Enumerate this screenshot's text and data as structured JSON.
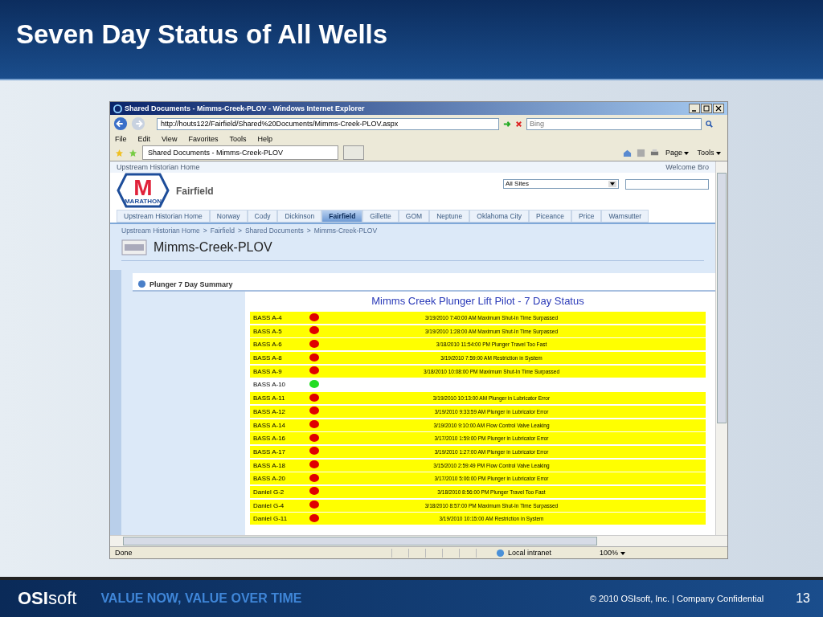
{
  "slide": {
    "title": "Seven Day Status of All Wells",
    "footer": {
      "logo": "**OSI**soft",
      "tagline": "VALUE NOW, VALUE OVER TIME",
      "copyright": "© 2010 OSIsoft, Inc.  |  Company Confidential",
      "page": "13"
    }
  },
  "window": {
    "title": "Shared Documents - Mimms-Creek-PLOV - Windows Internet Explorer",
    "address": "http://houts122/Fairfield/Shared%20Documents/Mimms-Creek-PLOV.aspx",
    "search": {
      "placeholder": "Bing"
    },
    "menu": [
      "File",
      "Edit",
      "View",
      "Favorites",
      "Tools",
      "Help"
    ],
    "tab": "Shared Documents - Mimms-Creek-PLOV",
    "commands": [
      "Page",
      "Tools"
    ],
    "status": {
      "text": "Done",
      "zone": "Local intranet",
      "zoom": "100%"
    }
  },
  "site": {
    "top_link": "Upstream Historian Home",
    "welcome": "Welcome Bro",
    "logo": {
      "letter": "M",
      "word": "MARATHON"
    },
    "site_title": "Fairfield",
    "scope": "All Sites",
    "tabs": [
      {
        "label": "Upstream Historian Home",
        "selected": false
      },
      {
        "label": "Norway",
        "selected": false
      },
      {
        "label": "Cody",
        "selected": false
      },
      {
        "label": "Dickinson",
        "selected": false
      },
      {
        "label": "Fairfield",
        "selected": true
      },
      {
        "label": "Gillette",
        "selected": false
      },
      {
        "label": "GOM",
        "selected": false
      },
      {
        "label": "Neptune",
        "selected": false
      },
      {
        "label": "Oklahoma City",
        "selected": false
      },
      {
        "label": "Piceance",
        "selected": false
      },
      {
        "label": "Price",
        "selected": false
      },
      {
        "label": "Wamsutter",
        "selected": false
      }
    ],
    "breadcrumb_separator": ">",
    "breadcrumb": [
      "Upstream Historian Home",
      "Fairfield",
      "Shared Documents",
      "Mimms-Creek-PLOV"
    ],
    "page_title": "Mimms-Creek-PLOV",
    "webpart_title": "Plunger 7 Day Summary"
  },
  "status_table": {
    "title": "Mimms Creek Plunger Lift Pilot - 7 Day Status",
    "rows": [
      {
        "well": "BASS A-4",
        "alarm": true,
        "color": "#e00000",
        "message": "3/19/2010 7:40:00 AM Maximum Shut-In Time Surpassed"
      },
      {
        "well": "BASS A-5",
        "alarm": true,
        "color": "#e00000",
        "message": "3/19/2010 1:28:00 AM Maximum Shut-In Time Surpassed"
      },
      {
        "well": "BASS A-6",
        "alarm": true,
        "color": "#e00000",
        "message": "3/18/2010 11:54:00 PM Plunger Travel Too Fast"
      },
      {
        "well": "BASS A-8",
        "alarm": true,
        "color": "#e00000",
        "message": "3/19/2010 7:59:00 AM Restriction in System"
      },
      {
        "well": "BASS A-9",
        "alarm": true,
        "color": "#e00000",
        "message": "3/18/2010 10:08:00 PM Maximum Shut-In Time Surpassed"
      },
      {
        "well": "BASS A-10",
        "alarm": false,
        "color": "#22dd22"
      },
      {
        "well": "BASS A-11",
        "alarm": true,
        "color": "#e00000",
        "message": "3/19/2010 10:13:00 AM Plunger in Lubricator Error"
      },
      {
        "well": "BASS A-12",
        "alarm": true,
        "color": "#e00000",
        "message": "3/19/2010 9:33:59 AM Plunger in Lubricator Error"
      },
      {
        "well": "BASS A-14",
        "alarm": true,
        "color": "#e00000",
        "message": "3/19/2010 9:10:00 AM Flow Control Valve Leaking"
      },
      {
        "well": "BASS A-16",
        "alarm": true,
        "color": "#e00000",
        "message": "3/17/2010 1:59:00 PM Plunger in Lubricator Error"
      },
      {
        "well": "BASS A-17",
        "alarm": true,
        "color": "#e00000",
        "message": "3/19/2010 1:27:00 AM Plunger in Lubricator Error"
      },
      {
        "well": "BASS A-18",
        "alarm": true,
        "color": "#e00000",
        "message": "3/15/2010 2:59:49 PM Flow Control Valve Leaking"
      },
      {
        "well": "BASS A-20",
        "alarm": true,
        "color": "#e00000",
        "message": "3/17/2010 5:06:00 PM Plunger in Lubricator Error"
      },
      {
        "well": "Daniel G-2",
        "alarm": true,
        "color": "#e00000",
        "message": "3/18/2010 8:56:00 PM Plunger Travel Too Fast"
      },
      {
        "well": "Daniel G-4",
        "alarm": true,
        "color": "#e00000",
        "message": "3/18/2010 8:57:00 PM Maximum Shut-In Time Surpassed"
      },
      {
        "well": "Daniel G-11",
        "alarm": true,
        "color": "#e00000",
        "message": "3/19/2010 10:15:00 AM Restriction in System"
      }
    ]
  }
}
